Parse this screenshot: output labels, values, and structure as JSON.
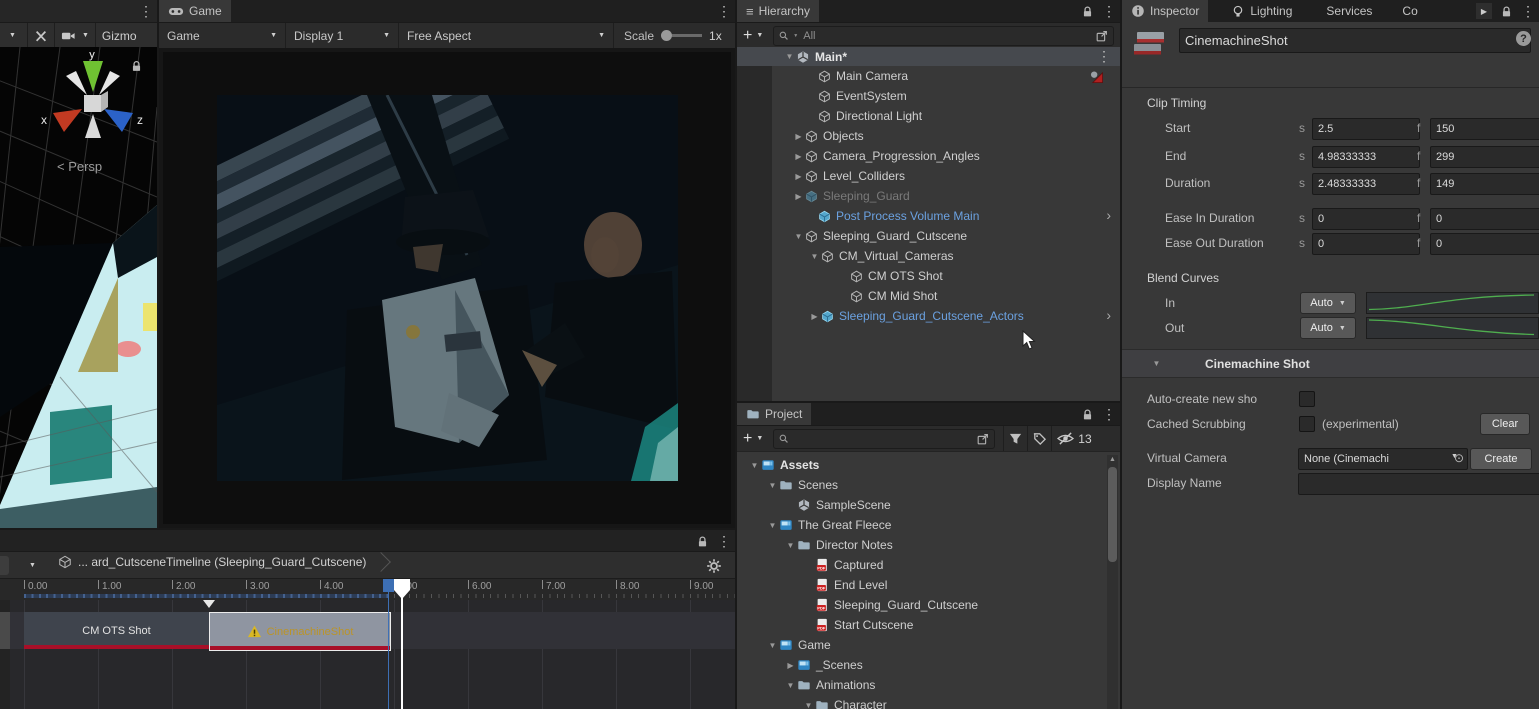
{
  "scene_view": {
    "persp_label": "< Persp",
    "axis": {
      "x": "x",
      "y": "y",
      "z": "z"
    },
    "toolbar": {
      "gizmos_label": "Gizmo"
    }
  },
  "game_view": {
    "tab_label": "Game",
    "toolbar": {
      "game_dropdown": "Game",
      "display_dropdown": "Display 1",
      "aspect_dropdown": "Free Aspect",
      "scale_label": "Scale",
      "scale_value": "1x"
    }
  },
  "hierarchy": {
    "tab_label": "Hierarchy",
    "create_button": "+",
    "search_placeholder": "All",
    "scene_header": "Main*",
    "items": [
      {
        "label": "Main Camera"
      },
      {
        "label": "EventSystem"
      },
      {
        "label": "Directional Light"
      },
      {
        "label": "Objects"
      },
      {
        "label": "Camera_Progression_Angles"
      },
      {
        "label": "Level_Colliders"
      },
      {
        "label": "Sleeping_Guard"
      },
      {
        "label": "Post Process Volume Main"
      },
      {
        "label": "Sleeping_Guard_Cutscene"
      },
      {
        "label": "CM_Virtual_Cameras"
      },
      {
        "label": "CM OTS Shot"
      },
      {
        "label": "CM Mid Shot"
      },
      {
        "label": "Sleeping_Guard_Cutscene_Actors"
      }
    ]
  },
  "project": {
    "tab_label": "Project",
    "create_button": "+",
    "hidden_count": "13",
    "items": [
      {
        "label": "Assets"
      },
      {
        "label": "Scenes"
      },
      {
        "label": "SampleScene"
      },
      {
        "label": "The Great Fleece"
      },
      {
        "label": "Director Notes"
      },
      {
        "label": "Captured"
      },
      {
        "label": "End Level"
      },
      {
        "label": "Sleeping_Guard_Cutscene"
      },
      {
        "label": "Start Cutscene"
      },
      {
        "label": "Game"
      },
      {
        "label": "_Scenes"
      },
      {
        "label": "Animations"
      },
      {
        "label": "Character"
      }
    ]
  },
  "timeline": {
    "breadcrumb": "... ard_CutsceneTimeline (Sleeping_Guard_Cutscene)",
    "ruler_labels": [
      "0.00",
      "1.00",
      "2.00",
      "3.00",
      "4.00",
      "5.00",
      "6.00",
      "7.00",
      "8.00",
      "9.00"
    ],
    "clips": [
      {
        "label": "CM OTS Shot"
      },
      {
        "label": "CinemachineShot",
        "warning": true
      }
    ]
  },
  "inspector": {
    "tabs": {
      "inspector": "Inspector",
      "lighting": "Lighting",
      "services": "Services",
      "collab": "Co"
    },
    "name_value": "CinemachineShot",
    "clip_timing": {
      "title": "Clip Timing",
      "s": "s",
      "f": "f",
      "rows": [
        {
          "label": "Start",
          "s": "2.5",
          "f": "150"
        },
        {
          "label": "End",
          "s": "4.98333333",
          "f": "299"
        },
        {
          "label": "Duration",
          "s": "2.48333333",
          "f": "149"
        },
        {
          "label": "Ease In Duration",
          "s": "0",
          "f": "0"
        },
        {
          "label": "Ease Out Duration",
          "s": "0",
          "f": "0"
        }
      ]
    },
    "blend_curves": {
      "title": "Blend Curves",
      "in_label": "In",
      "out_label": "Out",
      "in_mode": "Auto",
      "out_mode": "Auto"
    },
    "cinemachine_shot": {
      "title": "Cinemachine Shot",
      "auto_create_label": "Auto-create new sho",
      "cached_scrubbing_label": "Cached Scrubbing",
      "experimental_note": "(experimental)",
      "clear_button": "Clear",
      "virtual_camera_label": "Virtual Camera",
      "virtual_camera_value": "None (Cinemachi",
      "create_button": "Create",
      "display_name_label": "Display Name",
      "display_name_value": ""
    }
  },
  "colors": {
    "prefab_text_blue": "#6ba1e0",
    "clip_stripe_red": "#a80f28",
    "selected_clip_bg": "#8f95a1",
    "selected_clip_text": "#bb9428",
    "curve_green": "#4fae4f",
    "prefab_icon_blue": "#54a7cc",
    "timeline_range_blue": "#3d6fb4"
  },
  "icons": {
    "kebab-icon": "⋮",
    "picker-icon": "⊙",
    "help-icon": "?",
    "hierarchy-icon": "≡",
    "lock-icon": "padlock",
    "gear-icon": "gear",
    "search-icon": "magnifier",
    "warning-icon": "triangle"
  }
}
